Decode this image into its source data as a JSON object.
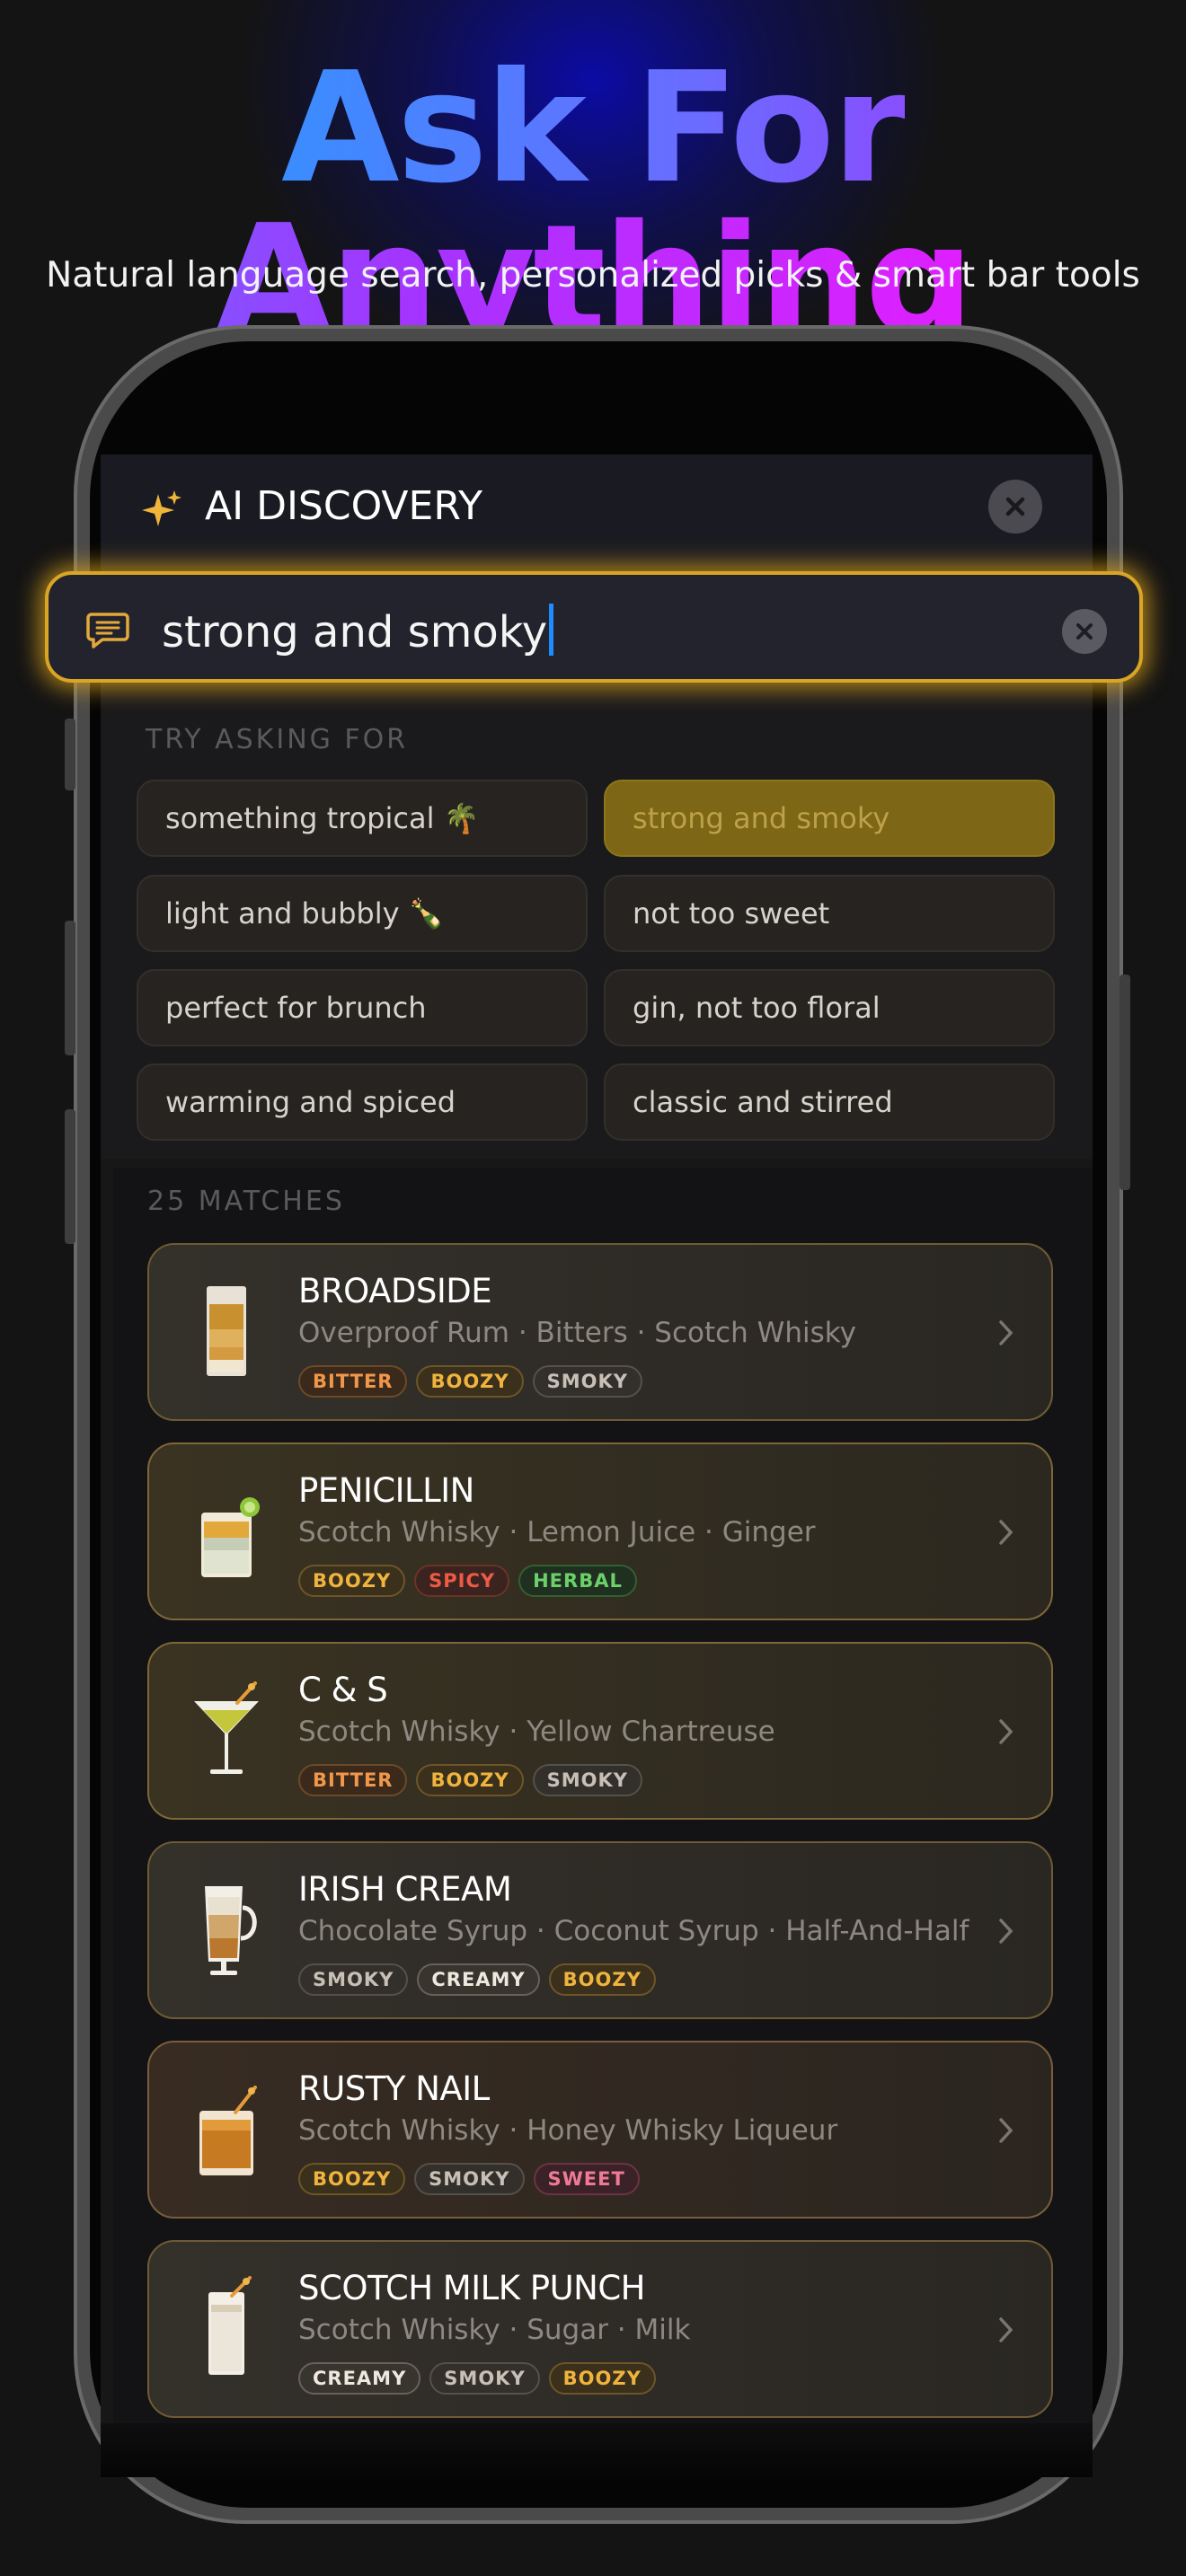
{
  "headline": "Ask For Anything",
  "subheadline": "Natural language search, personalized picks & smart bar tools",
  "sheet": {
    "title": "AI DISCOVERY"
  },
  "search": {
    "value": "strong and smoky"
  },
  "suggestions": {
    "label": "TRY ASKING FOR",
    "items": [
      {
        "label": "something tropical 🌴",
        "active": false
      },
      {
        "label": "strong and smoky",
        "active": true
      },
      {
        "label": "light and bubbly 🍾",
        "active": false
      },
      {
        "label": "not too sweet",
        "active": false
      },
      {
        "label": "perfect for brunch",
        "active": false
      },
      {
        "label": "gin, not too floral",
        "active": false
      },
      {
        "label": "warming and spiced",
        "active": false
      },
      {
        "label": "classic and stirred",
        "active": false
      }
    ]
  },
  "results": {
    "label": "25 MATCHES",
    "items": [
      {
        "name": "BROADSIDE",
        "ingredients": "Overproof Rum  ·  Bitters  ·  Scotch Whisky",
        "tags": [
          "BITTER",
          "BOOZY",
          "SMOKY"
        ],
        "glass": "highball-layered"
      },
      {
        "name": "PENICILLIN",
        "ingredients": "Scotch Whisky  ·  Lemon Juice  ·  Ginger",
        "tags": [
          "BOOZY",
          "SPICY",
          "HERBAL"
        ],
        "glass": "rocks-lime"
      },
      {
        "name": "C & S",
        "ingredients": "Scotch Whisky  ·  Yellow Chartreuse",
        "tags": [
          "BITTER",
          "BOOZY",
          "SMOKY"
        ],
        "glass": "martini"
      },
      {
        "name": "IRISH CREAM",
        "ingredients": "Chocolate Syrup  ·  Coconut Syrup  ·  Half-And-Half",
        "tags": [
          "SMOKY",
          "CREAMY",
          "BOOZY"
        ],
        "glass": "mug"
      },
      {
        "name": "RUSTY NAIL",
        "ingredients": "Scotch Whisky  ·  Honey Whisky Liqueur",
        "tags": [
          "BOOZY",
          "SMOKY",
          "SWEET"
        ],
        "glass": "rocks-amber"
      },
      {
        "name": "SCOTCH MILK PUNCH",
        "ingredients": "Scotch Whisky  ·  Sugar  ·  Milk",
        "tags": [
          "CREAMY",
          "SMOKY",
          "BOOZY"
        ],
        "glass": "highball-milk"
      }
    ]
  },
  "colors": {
    "accent": "#d9a524",
    "headline_gradient": [
      "#3a8dff",
      "#a533ff",
      "#e01fff"
    ],
    "caret": "#1e8cff"
  }
}
